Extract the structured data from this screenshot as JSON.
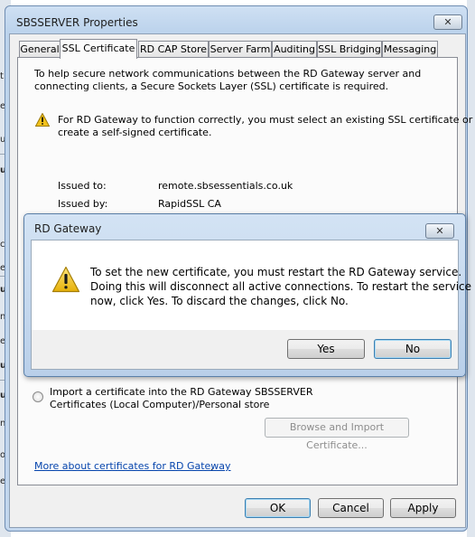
{
  "window": {
    "title": "SBSSERVER Properties",
    "close_label": "✕",
    "tabs": [
      {
        "label": "General"
      },
      {
        "label": "SSL Certificate",
        "active": true
      },
      {
        "label": "RD CAP Store"
      },
      {
        "label": "Server Farm"
      },
      {
        "label": "Auditing"
      },
      {
        "label": "SSL Bridging"
      },
      {
        "label": "Messaging"
      }
    ]
  },
  "ssl": {
    "intro_line1": "To help secure network communications between the RD Gateway server and",
    "intro_line2": "connecting clients, a Secure Sockets Layer (SSL) certificate is required.",
    "warning_line1": "For RD Gateway to function correctly, you must select an existing SSL certificate or",
    "warning_line2": "create a self-signed certificate.",
    "issued_to_label": "Issued to:",
    "issued_to_value": "remote.sbsessentials.co.uk",
    "issued_by_label": "Issued by:",
    "issued_by_value": "RapidSSL CA",
    "import_line1": "Import a certificate into the RD Gateway SBSSERVER",
    "import_line2": "Certificates (Local Computer)/Personal store",
    "browse_button": "Browse and Import Certificate...",
    "more_link": "More about certificates for RD Gateway",
    "link_period": "."
  },
  "footer": {
    "ok": "OK",
    "cancel": "Cancel",
    "apply": "Apply"
  },
  "dialog": {
    "title": "RD Gateway",
    "close_label": "✕",
    "message_line1": "To set the new certificate, you must restart the RD Gateway service.",
    "message_line2": "Doing this will disconnect all active connections. To restart the service",
    "message_line3": "now, click Yes. To discard the changes, click No.",
    "yes": "Yes",
    "no": "No"
  },
  "background_fragments": [
    "t",
    "e",
    "u",
    "u",
    "ct",
    "e",
    "u",
    "n",
    "e",
    "u",
    "u",
    "n",
    "ot",
    "e"
  ],
  "colors": {
    "window_frame": "#bcd3ec",
    "link": "#0645ad",
    "warning": "#f2c21a"
  }
}
